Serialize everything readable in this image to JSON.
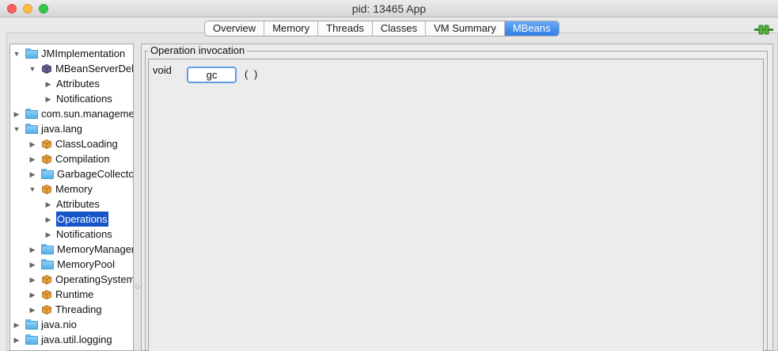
{
  "window": {
    "title": "pid: 13465 App"
  },
  "tabs": [
    {
      "label": "Overview"
    },
    {
      "label": "Memory"
    },
    {
      "label": "Threads"
    },
    {
      "label": "Classes"
    },
    {
      "label": "VM Summary"
    },
    {
      "label": "MBeans",
      "active": true
    }
  ],
  "tree": {
    "nodes": [
      {
        "label": "JMImplementation",
        "icon": "folder-icon",
        "expanded": true
      },
      {
        "label": "MBeanServerDele",
        "icon": "mbean-icon",
        "expanded": true
      },
      {
        "label": "Attributes",
        "icon": "none",
        "expanded": false
      },
      {
        "label": "Notifications",
        "icon": "none",
        "expanded": false
      },
      {
        "label": "com.sun.manageme",
        "icon": "folder-icon",
        "expanded": false
      },
      {
        "label": "java.lang",
        "icon": "folder-icon",
        "expanded": true
      },
      {
        "label": "ClassLoading",
        "icon": "mbean-icon",
        "expanded": false
      },
      {
        "label": "Compilation",
        "icon": "mbean-icon",
        "expanded": false
      },
      {
        "label": "GarbageCollecto",
        "icon": "folder-icon",
        "expanded": false
      },
      {
        "label": "Memory",
        "icon": "mbean-icon",
        "expanded": true
      },
      {
        "label": "Attributes",
        "icon": "none",
        "expanded": false
      },
      {
        "label": "Operations",
        "icon": "none",
        "expanded": false,
        "selected": true
      },
      {
        "label": "Notifications",
        "icon": "none",
        "expanded": false
      },
      {
        "label": "MemoryManager",
        "icon": "folder-icon",
        "expanded": false
      },
      {
        "label": "MemoryPool",
        "icon": "folder-icon",
        "expanded": false
      },
      {
        "label": "OperatingSystem",
        "icon": "mbean-icon",
        "expanded": false
      },
      {
        "label": "Runtime",
        "icon": "mbean-icon",
        "expanded": false
      },
      {
        "label": "Threading",
        "icon": "mbean-icon",
        "expanded": false
      },
      {
        "label": "java.nio",
        "icon": "folder-icon",
        "expanded": false
      },
      {
        "label": "java.util.logging",
        "icon": "folder-icon",
        "expanded": false
      }
    ]
  },
  "operations": {
    "title": "Operation invocation",
    "items": [
      {
        "return_type": "void",
        "name": "gc",
        "params": "( )"
      }
    ]
  },
  "colors": {
    "selection": "#1555c8",
    "active_tab": "#2f7de6",
    "button_focus": "#5e9ce8"
  }
}
